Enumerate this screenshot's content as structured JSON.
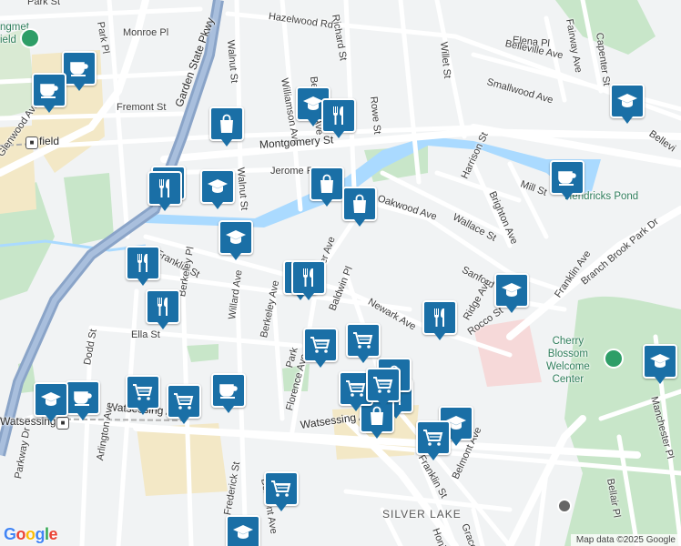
{
  "map": {
    "streets": [
      {
        "name": "Park St"
      },
      {
        "name": "Park Pl"
      },
      {
        "name": "Monroe Pl"
      },
      {
        "name": "Hazelwood Rd"
      },
      {
        "name": "Walnut St"
      },
      {
        "name": "Williamson Ave"
      },
      {
        "name": "Belleville Ave"
      },
      {
        "name": "Elena Pl"
      },
      {
        "name": "Fairway Ave"
      },
      {
        "name": "Capenter St"
      },
      {
        "name": "Smallwood Ave"
      },
      {
        "name": "Willet St"
      },
      {
        "name": "Rowe St"
      },
      {
        "name": "Fremont St"
      },
      {
        "name": "Montgomery St"
      },
      {
        "name": "Jerome Pl"
      },
      {
        "name": "Walnut St"
      },
      {
        "name": "Glenwood Ave"
      },
      {
        "name": "Garden State Pkwy"
      },
      {
        "name": "Oakwood Ave"
      },
      {
        "name": "Mill St"
      },
      {
        "name": "Wallace St"
      },
      {
        "name": "Brighton Ave"
      },
      {
        "name": "Harrison St"
      },
      {
        "name": "Franklin St"
      },
      {
        "name": "Berkeley Pl"
      },
      {
        "name": "Willard Ave"
      },
      {
        "name": "Weaver Ave"
      },
      {
        "name": "Sanford"
      },
      {
        "name": "Newark Ave"
      },
      {
        "name": "Baldwin Pl"
      },
      {
        "name": "Berkeley Ave"
      },
      {
        "name": "Park"
      },
      {
        "name": "Ella St"
      },
      {
        "name": "Florence Ave"
      },
      {
        "name": "Ridge Ave"
      },
      {
        "name": "Franklin Ave"
      },
      {
        "name": "Branch Brook Park Dr"
      },
      {
        "name": "Rocco St"
      },
      {
        "name": "Dodd St"
      },
      {
        "name": "Watsessing Ave"
      },
      {
        "name": "Arlington Ave"
      },
      {
        "name": "Parkway Dr"
      },
      {
        "name": "Franklin St"
      },
      {
        "name": "Belmont Ave"
      },
      {
        "name": "Manchester Pl"
      },
      {
        "name": "Watsessing Ave"
      },
      {
        "name": "Bellair Pl"
      },
      {
        "name": "Honiss"
      },
      {
        "name": "Grace"
      },
      {
        "name": "Bellevi"
      },
      {
        "name": "Richard St"
      },
      {
        "name": "Belleville Ave"
      },
      {
        "name": "Frederick St"
      },
      {
        "name": "Watsessing Ave"
      },
      {
        "name": "Belmont Ave"
      }
    ],
    "places": {
      "hendricks": "Hendricks Pond",
      "cherry": [
        "Cherry",
        "Blossom",
        "Welcome",
        "Center"
      ],
      "silver": "SILVER LAKE",
      "watsessing_stn": "Watsessing",
      "bloomfield_stn": "field",
      "museum_top": [
        "ngmet",
        "ield"
      ]
    },
    "pins": [
      {
        "type": "coffee"
      },
      {
        "type": "coffee"
      },
      {
        "type": "coffee"
      },
      {
        "type": "coffee"
      },
      {
        "type": "coffee"
      },
      {
        "type": "school"
      },
      {
        "type": "school"
      },
      {
        "type": "school"
      },
      {
        "type": "school"
      },
      {
        "type": "school"
      },
      {
        "type": "school"
      },
      {
        "type": "school"
      },
      {
        "type": "school"
      },
      {
        "type": "school"
      },
      {
        "type": "school"
      },
      {
        "type": "restaurant"
      },
      {
        "type": "restaurant"
      },
      {
        "type": "restaurant"
      },
      {
        "type": "restaurant"
      },
      {
        "type": "restaurant"
      },
      {
        "type": "restaurant"
      },
      {
        "type": "restaurant"
      },
      {
        "type": "restaurant"
      },
      {
        "type": "shopping"
      },
      {
        "type": "shopping"
      },
      {
        "type": "shopping"
      },
      {
        "type": "shopping"
      },
      {
        "type": "shopping"
      },
      {
        "type": "grocery"
      },
      {
        "type": "grocery"
      },
      {
        "type": "grocery"
      },
      {
        "type": "grocery"
      },
      {
        "type": "grocery"
      },
      {
        "type": "grocery"
      },
      {
        "type": "grocery"
      },
      {
        "type": "grocery"
      }
    ]
  },
  "logo": "Google",
  "attribution": "Map data ©2025 Google",
  "colors": {
    "pin": "#1a6fa6",
    "water": "#aadaff",
    "park": "#c8e6c9",
    "highway": "#8aa4c8",
    "commercial": "#f3e8c6"
  }
}
